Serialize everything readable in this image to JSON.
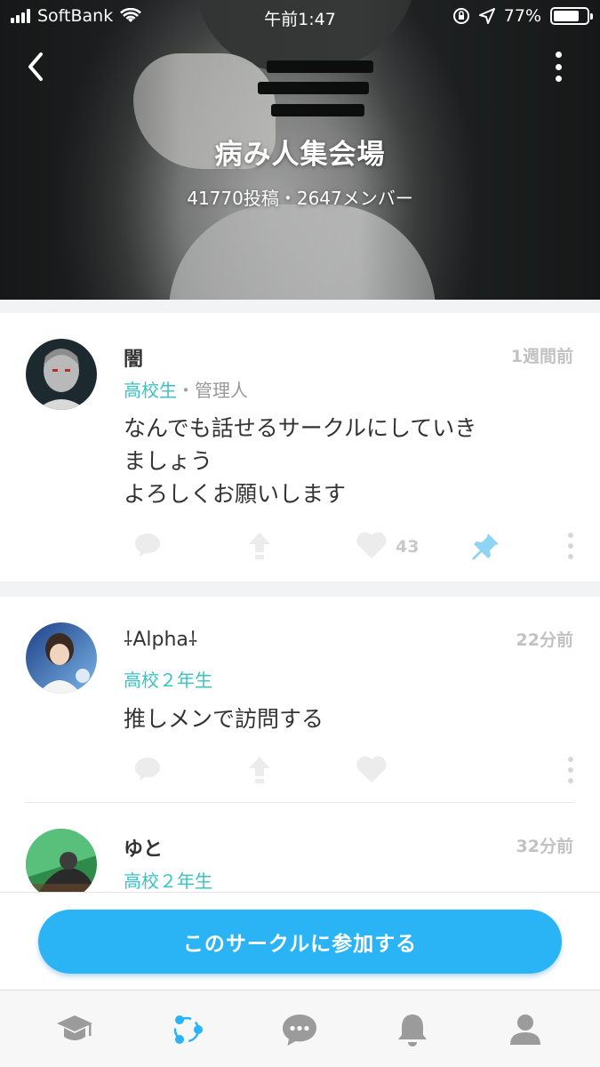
{
  "status_bar": {
    "carrier": "SoftBank",
    "time": "午前1:47",
    "battery": "77%",
    "battery_level": 0.77
  },
  "header": {
    "title": "病み人集会場",
    "stats": "41770投稿・2647メンバー"
  },
  "posts": [
    {
      "author": "闇",
      "time": "1週間前",
      "role": "高校生",
      "separator": "・",
      "badge": "管理人",
      "lines": [
        "なんでも話せるサークルにしていき",
        "ましょう",
        "よろしくお願いします"
      ],
      "likes": "43",
      "pinned": true
    },
    {
      "author": "⸸Alpha⸸",
      "time": "22分前",
      "role": "高校２年生",
      "lines": [
        "推しメンで訪問する"
      ]
    },
    {
      "author": "ゆと",
      "time": "32分前",
      "role": "高校２年生"
    }
  ],
  "join_button": {
    "label": "このサークルに参加する"
  },
  "tabs": [
    "graduation-cap-icon",
    "circle-network-icon",
    "chat-bubble-icon",
    "bell-icon",
    "profile-icon"
  ],
  "colors": {
    "accent": "#2ab3f5",
    "role": "#3ac3c4",
    "active_tab": "#2ab3f5"
  }
}
